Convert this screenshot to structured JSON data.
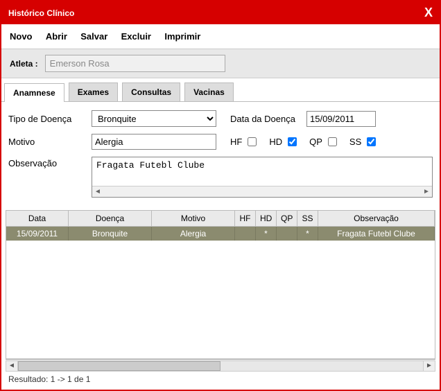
{
  "window": {
    "title": "Histórico Clínico"
  },
  "menu": {
    "novo": "Novo",
    "abrir": "Abrir",
    "salvar": "Salvar",
    "excluir": "Excluir",
    "imprimir": "Imprimir"
  },
  "atleta": {
    "label": "Atleta :",
    "value": "Emerson Rosa"
  },
  "tabs": {
    "anamnese": "Anamnese",
    "exames": "Exames",
    "consultas": "Consultas",
    "vacinas": "Vacinas"
  },
  "form": {
    "tipo_doenca_label": "Tipo de Doença",
    "tipo_doenca_value": "Bronquite",
    "data_doenca_label": "Data da Doença",
    "data_doenca_value": "15/09/2011",
    "motivo_label": "Motivo",
    "motivo_value": "Alergia",
    "hf_label": "HF",
    "hf_checked": false,
    "hd_label": "HD",
    "hd_checked": true,
    "qp_label": "QP",
    "qp_checked": false,
    "ss_label": "SS",
    "ss_checked": true,
    "obs_label": "Observação",
    "obs_value": "Fragata Futebl Clube"
  },
  "grid": {
    "headers": {
      "data": "Data",
      "doenca": "Doença",
      "motivo": "Motivo",
      "hf": "HF",
      "hd": "HD",
      "qp": "QP",
      "ss": "SS",
      "obs": "Observação"
    },
    "rows": [
      {
        "data": "15/09/2011",
        "doenca": "Bronquite",
        "motivo": "Alergia",
        "hf": "",
        "hd": "*",
        "qp": "",
        "ss": "*",
        "obs": "Fragata Futebl Clube"
      }
    ]
  },
  "result": "Resultado: 1 -> 1 de 1"
}
